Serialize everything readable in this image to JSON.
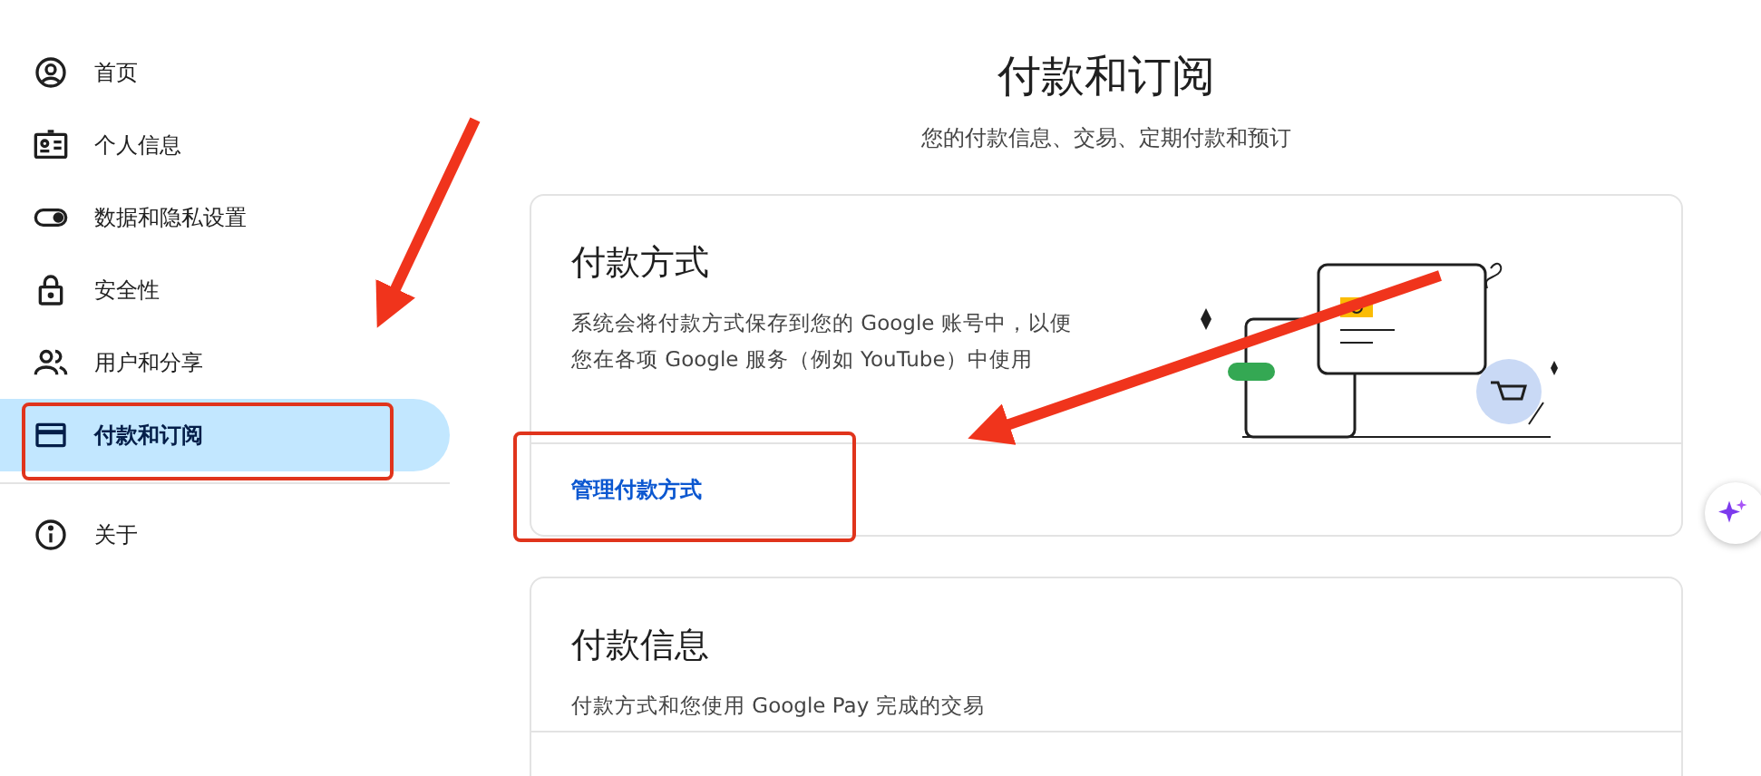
{
  "sidebar": {
    "items": [
      {
        "label": "首页",
        "kind": "home",
        "selected": false
      },
      {
        "label": "个人信息",
        "kind": "id",
        "selected": false
      },
      {
        "label": "数据和隐私设置",
        "kind": "toggle",
        "selected": false
      },
      {
        "label": "安全性",
        "kind": "lock",
        "selected": false
      },
      {
        "label": "用户和分享",
        "kind": "people",
        "selected": false
      },
      {
        "label": "付款和订阅",
        "kind": "card",
        "selected": true
      }
    ],
    "footer_items": [
      {
        "label": "关于",
        "kind": "info",
        "selected": false
      }
    ]
  },
  "header": {
    "title": "付款和订阅",
    "subtitle": "您的付款信息、交易、定期付款和预订"
  },
  "cards": [
    {
      "title": "付款方式",
      "description": [
        "系统会将付款方式保存到您的 Google 账号中，以便",
        "您在各项 Google 服务（例如 YouTube）中使用"
      ],
      "link": "管理付款方式",
      "illustration": true
    },
    {
      "title": "付款信息",
      "description": [
        "付款方式和您使用 Google Pay 完成的交易"
      ],
      "illustration": false
    }
  ]
}
